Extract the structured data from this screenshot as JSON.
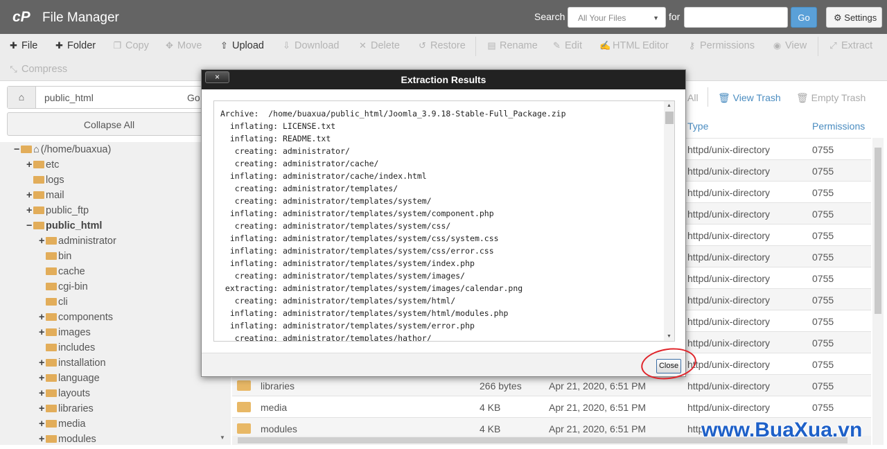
{
  "header": {
    "app_title": "File Manager",
    "search_label": "Search",
    "search_scope": "All Your Files",
    "for_label": "for",
    "search_value": "",
    "go_label": "Go",
    "settings_label": "Settings"
  },
  "toolbar": {
    "file": "File",
    "folder": "Folder",
    "copy": "Copy",
    "move": "Move",
    "upload": "Upload",
    "download": "Download",
    "delete": "Delete",
    "restore": "Restore",
    "rename": "Rename",
    "edit": "Edit",
    "html_editor": "HTML Editor",
    "permissions": "Permissions",
    "view": "View",
    "extract": "Extract",
    "compress": "Compress"
  },
  "left": {
    "path": "public_html",
    "go": "Go",
    "collapse_all": "Collapse All",
    "tree": [
      {
        "label": "(/home/buaxua)",
        "sign": "−"
      },
      {
        "label": "etc",
        "sign": "+"
      },
      {
        "label": "logs",
        "sign": ""
      },
      {
        "label": "mail",
        "sign": "+"
      },
      {
        "label": "public_ftp",
        "sign": "+"
      },
      {
        "label": "public_html",
        "sign": "−"
      },
      {
        "label": "administrator",
        "sign": "+"
      },
      {
        "label": "bin",
        "sign": ""
      },
      {
        "label": "cache",
        "sign": ""
      },
      {
        "label": "cgi-bin",
        "sign": ""
      },
      {
        "label": "cli",
        "sign": ""
      },
      {
        "label": "components",
        "sign": "+"
      },
      {
        "label": "images",
        "sign": "+"
      },
      {
        "label": "includes",
        "sign": ""
      },
      {
        "label": "installation",
        "sign": "+"
      },
      {
        "label": "language",
        "sign": "+"
      },
      {
        "label": "layouts",
        "sign": "+"
      },
      {
        "label": "libraries",
        "sign": "+"
      },
      {
        "label": "media",
        "sign": "+"
      },
      {
        "label": "modules",
        "sign": "+"
      }
    ]
  },
  "right": {
    "select_all": "All",
    "view_trash": "View Trash",
    "empty_trash": "Empty Trash",
    "col_type": "Type",
    "col_permissions": "Permissions",
    "rows": [
      {
        "name": "",
        "size": "",
        "date": "",
        "type": "httpd/unix-directory",
        "perm": "0755"
      },
      {
        "name": "",
        "size": "",
        "date": "",
        "type": "httpd/unix-directory",
        "perm": "0755"
      },
      {
        "name": "",
        "size": "",
        "date": "",
        "type": "httpd/unix-directory",
        "perm": "0755"
      },
      {
        "name": "",
        "size": "",
        "date": "",
        "type": "httpd/unix-directory",
        "perm": "0755"
      },
      {
        "name": "",
        "size": "",
        "date": "",
        "type": "httpd/unix-directory",
        "perm": "0755"
      },
      {
        "name": "",
        "size": "",
        "date": "",
        "type": "httpd/unix-directory",
        "perm": "0755"
      },
      {
        "name": "",
        "size": "",
        "date": "",
        "type": "httpd/unix-directory",
        "perm": "0755"
      },
      {
        "name": "",
        "size": "",
        "date": "",
        "type": "httpd/unix-directory",
        "perm": "0755"
      },
      {
        "name": "",
        "size": "",
        "date": "",
        "type": "httpd/unix-directory",
        "perm": "0755"
      },
      {
        "name": "",
        "size": "",
        "date": "",
        "type": "httpd/unix-directory",
        "perm": "0755"
      },
      {
        "name": "",
        "size": "",
        "date": "",
        "type": "httpd/unix-directory",
        "perm": "0755"
      },
      {
        "name": "libraries",
        "size": "266 bytes",
        "date": "Apr 21, 2020, 6:51 PM",
        "type": "httpd/unix-directory",
        "perm": "0755"
      },
      {
        "name": "media",
        "size": "4 KB",
        "date": "Apr 21, 2020, 6:51 PM",
        "type": "httpd/unix-directory",
        "perm": "0755"
      },
      {
        "name": "modules",
        "size": "4 KB",
        "date": "Apr 21, 2020, 6:51 PM",
        "type": "http",
        "perm": ""
      }
    ]
  },
  "dialog": {
    "title": "Extraction Results",
    "close_x": "×",
    "close_label": "Close",
    "lines": [
      "Archive:  /home/buaxua/public_html/Joomla_3.9.18-Stable-Full_Package.zip",
      "  inflating: LICENSE.txt",
      "  inflating: README.txt",
      "   creating: administrator/",
      "   creating: administrator/cache/",
      "  inflating: administrator/cache/index.html",
      "   creating: administrator/templates/",
      "   creating: administrator/templates/system/",
      "  inflating: administrator/templates/system/component.php",
      "   creating: administrator/templates/system/css/",
      "  inflating: administrator/templates/system/css/system.css",
      "  inflating: administrator/templates/system/css/error.css",
      "  inflating: administrator/templates/system/index.php",
      "   creating: administrator/templates/system/images/",
      " extracting: administrator/templates/system/images/calendar.png",
      "   creating: administrator/templates/system/html/",
      "  inflating: administrator/templates/system/html/modules.php",
      "  inflating: administrator/templates/system/error.php",
      "   creating: administrator/templates/hathor/"
    ]
  },
  "watermark": "www.BuaXua.vn",
  "colors": {
    "header": "#646464",
    "accent": "#4a8cc0",
    "folder": "#e8b866",
    "highlight_ring": "#e0252b"
  }
}
